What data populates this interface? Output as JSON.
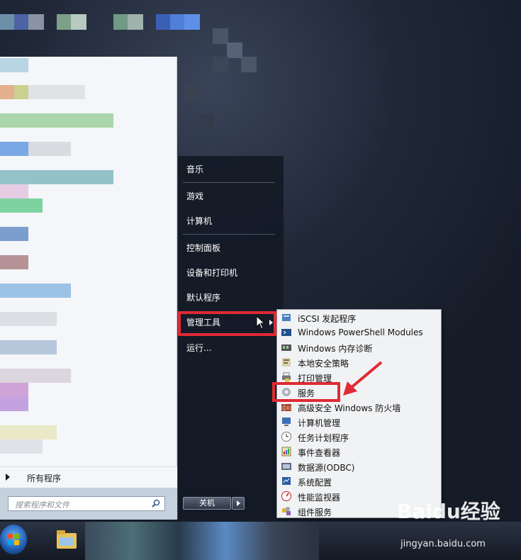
{
  "start_menu": {
    "all_programs": "所有程序",
    "search_placeholder": "搜索程序和文件",
    "right_items": [
      "音乐",
      "游戏",
      "计算机",
      "控制面板",
      "设备和打印机",
      "默认程序",
      "管理工具",
      "运行..."
    ],
    "shutdown_label": "关机"
  },
  "submenu": {
    "items": [
      {
        "label": "iSCSI 发起程序",
        "icon": "iscsi-icon"
      },
      {
        "label": "Windows PowerShell Modules",
        "icon": "powershell-icon"
      },
      {
        "label": "Windows 内存诊断",
        "icon": "memory-diagnostic-icon"
      },
      {
        "label": "本地安全策略",
        "icon": "security-policy-icon"
      },
      {
        "label": "打印管理",
        "icon": "print-management-icon"
      },
      {
        "label": "服务",
        "icon": "services-gear-icon"
      },
      {
        "label": "高级安全 Windows 防火墙",
        "icon": "firewall-icon"
      },
      {
        "label": "计算机管理",
        "icon": "computer-management-icon"
      },
      {
        "label": "任务计划程序",
        "icon": "task-scheduler-icon"
      },
      {
        "label": "事件查看器",
        "icon": "event-viewer-icon"
      },
      {
        "label": "数据源(ODBC)",
        "icon": "odbc-icon"
      },
      {
        "label": "系统配置",
        "icon": "system-config-icon"
      },
      {
        "label": "性能监视器",
        "icon": "performance-monitor-icon"
      },
      {
        "label": "组件服务",
        "icon": "component-services-icon"
      }
    ]
  },
  "watermark": {
    "brand": "Baidu经验",
    "url": "jingyan.baidu.com"
  },
  "colors": {
    "highlight_red": "#e02a34",
    "menu_dark": "#141a26",
    "submenu_bg": "#f1f2f4"
  }
}
